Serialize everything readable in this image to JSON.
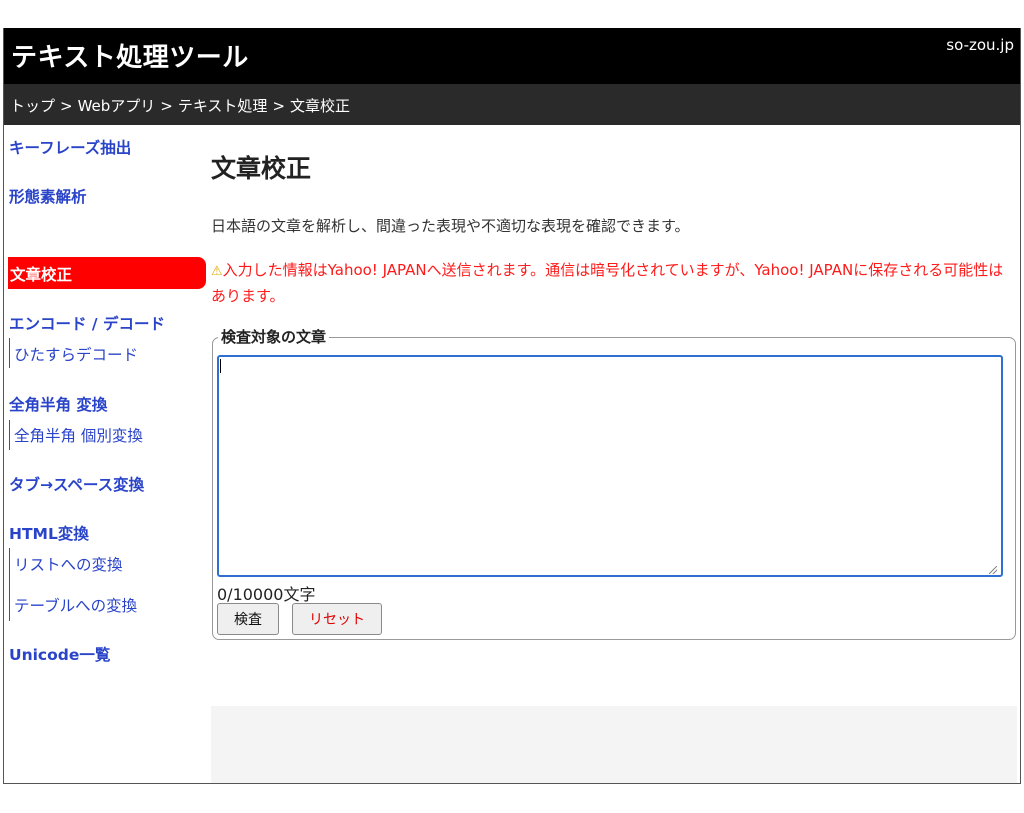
{
  "header": {
    "site_title": "テキスト処理ツール",
    "site_domain": "so-zou.jp"
  },
  "breadcrumb": {
    "items": [
      "トップ",
      "Webアプリ",
      "テキスト処理",
      "文章校正"
    ],
    "separator": ">"
  },
  "sidebar": {
    "items": {
      "keyphrase": "キーフレーズ抽出",
      "morph": "形態素解析",
      "proofread": "文章校正",
      "encode": "エンコード / デコード",
      "hitasura": "ひたすらデコード",
      "zenkaku": "全角半角 変換",
      "zenkaku_each": "全角半角 個別変換",
      "tab_space": "タブ→スペース変換",
      "html": "HTML変換",
      "to_list": "リストへの変換",
      "to_table": "テーブルへの変換",
      "unicode": "Unicode一覧"
    },
    "active_color": "#ff0000",
    "link_color": "#2a44c9"
  },
  "main": {
    "title": "文章校正",
    "description": "日本語の文章を解析し、間違った表現や不適切な表現を確認できます。",
    "warning_icon": "warning-icon",
    "warning": "入力した情報はYahoo! JAPANへ送信されます。通信は暗号化されていますが、Yahoo! JAPANに保存される可能性はあります。",
    "form": {
      "legend": "検査対象の文章",
      "textarea_value": "",
      "counter": "0/10000文字",
      "check_button": "検査",
      "reset_button": "リセット"
    }
  }
}
